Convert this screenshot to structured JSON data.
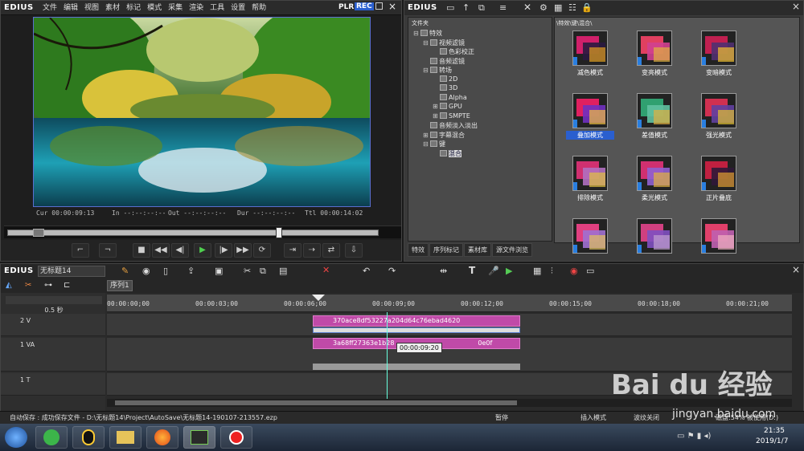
{
  "player": {
    "logo": "EDIUS",
    "menu": [
      "文件",
      "编辑",
      "视图",
      "素材",
      "标记",
      "模式",
      "采集",
      "渲染",
      "工具",
      "设置",
      "帮助"
    ],
    "plr_label": "PLR",
    "rec_label": "REC",
    "timecodes": {
      "cur_label": "Cur",
      "cur_value": "00:00:09:13",
      "in_label": "In",
      "in_value": "--:--:--:--",
      "out_label": "Out",
      "out_value": "--:--:--:--",
      "dur_label": "Dur",
      "dur_value": "--:--:--:--",
      "ttl_label": "Ttl",
      "ttl_value": "00:00:14:02"
    },
    "transport_icons": [
      "mark-in-icon",
      "mark-out-icon",
      "stop-icon",
      "rewind-icon",
      "step-back-icon",
      "play-icon",
      "step-forward-icon",
      "fast-forward-icon",
      "loop-icon",
      "insert-icon",
      "overwrite-icon",
      "replace-icon",
      "export-icon"
    ]
  },
  "fx": {
    "logo": "EDIUS",
    "tree_header": "文件夹",
    "path": "\\特效\\键\\混合\\",
    "tree": [
      {
        "label": "特效",
        "indent": 0,
        "expander": "-"
      },
      {
        "label": "视频滤镜",
        "indent": 1,
        "expander": "-"
      },
      {
        "label": "色彩校正",
        "indent": 2,
        "expander": ""
      },
      {
        "label": "音频滤镜",
        "indent": 1,
        "expander": ""
      },
      {
        "label": "转场",
        "indent": 1,
        "expander": "-"
      },
      {
        "label": "2D",
        "indent": 2,
        "expander": ""
      },
      {
        "label": "3D",
        "indent": 2,
        "expander": ""
      },
      {
        "label": "Alpha",
        "indent": 2,
        "expander": ""
      },
      {
        "label": "GPU",
        "indent": 2,
        "expander": "+"
      },
      {
        "label": "SMPTE",
        "indent": 2,
        "expander": "+"
      },
      {
        "label": "音频淡入淡出",
        "indent": 1,
        "expander": ""
      },
      {
        "label": "字幕混合",
        "indent": 1,
        "expander": "+"
      },
      {
        "label": "键",
        "indent": 1,
        "expander": "-"
      },
      {
        "label": "混合",
        "indent": 2,
        "expander": "",
        "selected": true
      }
    ],
    "effects": [
      "减色模式",
      "变亮模式",
      "变暗模式",
      "叠加模式",
      "差值模式",
      "强光模式",
      "排除模式",
      "柔光模式",
      "正片叠底",
      "",
      "",
      ""
    ],
    "selected_effect": "叠加模式",
    "tabs": [
      "特效",
      "序列标记",
      "素材库",
      "源文件浏览"
    ]
  },
  "timeline": {
    "logo": "EDIUS",
    "project_name": "无标题14",
    "sequence_tab": "序列1",
    "zoom_label": "0.5 秒",
    "ruler": [
      "00:00:00;00",
      "00:00:03;00",
      "00:00:06;00",
      "00:00:09;00",
      "00:00:12;00",
      "00:00:15;00",
      "00:00:18;00",
      "00:00:21;00"
    ],
    "tracks": [
      {
        "name": "2 V",
        "clip": "370ace8df53227a204d64c76ebad4620"
      },
      {
        "name": "1 VA",
        "clip": "3a68ff27363e1b28",
        "clip_tail": "0e0f"
      },
      {
        "name": "1 T",
        "clip": ""
      }
    ],
    "tooltip": "00:00:09:20"
  },
  "status": {
    "autosave": "自动保存 : 成功保存文件 - D:\\无标题14\\Project\\AutoSave\\无标题14-190107-213557.ezp",
    "state": "暂停",
    "mode": "插入模式",
    "ripple": "波纹关闭",
    "disk": "磁盘:54% 被使用(D:)"
  },
  "taskbar": {
    "time": "21:35",
    "date": "2019/1/7"
  },
  "watermark": {
    "text": "Bai  du 经验",
    "url": "jingyan.baidu.com"
  }
}
